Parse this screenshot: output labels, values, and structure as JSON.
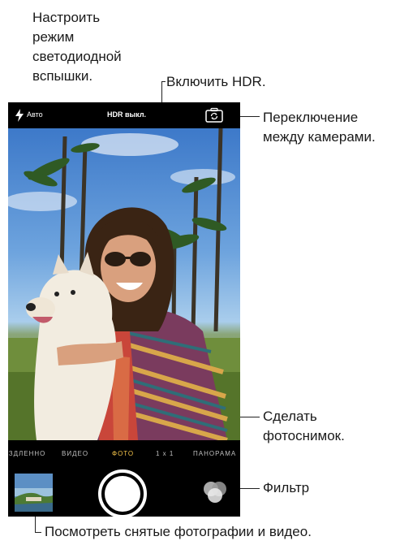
{
  "callouts": {
    "flash": "Настроить\nрежим\nсветодиодной\nвспышки.",
    "hdr": "Включить HDR.",
    "switch_camera": "Переключение\nмежду камерами.",
    "shutter": "Сделать\nфотоснимок.",
    "filter": "Фильтр",
    "photos": "Посмотреть снятые фотографии и видео."
  },
  "camera": {
    "flash_label": "Авто",
    "hdr_label": "HDR выкл.",
    "modes": [
      "ИЗДЛЕННО",
      "ВИДЕО",
      "ФОТО",
      "1 x 1",
      "ПАНОРАМА"
    ],
    "active_mode": "ФОТО"
  },
  "icons": {
    "flash": "flash-icon",
    "switch": "camera-switch-icon",
    "filter": "filter-icon"
  },
  "colors": {
    "active_mode": "#f2c24a",
    "bar": "#000000"
  }
}
